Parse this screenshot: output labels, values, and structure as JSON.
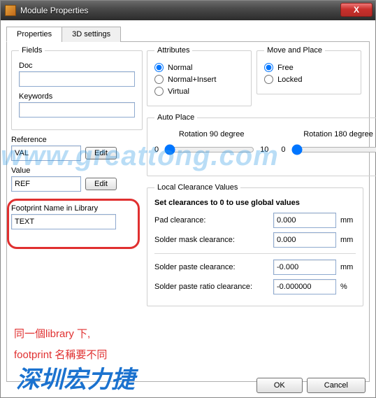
{
  "window": {
    "title": "Module Properties",
    "close": "X"
  },
  "tabs": {
    "properties": "Properties",
    "threeD": "3D settings"
  },
  "fields": {
    "legend": "Fields",
    "doc_label": "Doc",
    "doc_value": "",
    "keywords_label": "Keywords",
    "keywords_value": ""
  },
  "reference": {
    "label": "Reference",
    "value": "VAL",
    "edit": "Edit"
  },
  "value": {
    "label": "Value",
    "value": "REF",
    "edit": "Edit"
  },
  "footprint": {
    "label": "Footprint Name in Library",
    "value": "TEXT"
  },
  "attributes": {
    "legend": "Attributes",
    "normal": "Normal",
    "normal_insert": "Normal+Insert",
    "virtual": "Virtual",
    "selected": "normal"
  },
  "move": {
    "legend": "Move and Place",
    "free": "Free",
    "locked": "Locked",
    "selected": "free"
  },
  "autoplace": {
    "legend": "Auto Place",
    "rot90": "Rotation 90 degree",
    "rot180": "Rotation 180 degree",
    "min": "0",
    "max": "10",
    "val90": 0,
    "val180": 0
  },
  "clearance": {
    "legend": "Local Clearance Values",
    "header": "Set clearances to 0 to use global values",
    "pad_label": "Pad clearance:",
    "pad_value": "0.000",
    "pad_unit": "mm",
    "mask_label": "Solder mask clearance:",
    "mask_value": "0.000",
    "mask_unit": "mm",
    "paste_label": "Solder paste clearance:",
    "paste_value": "-0.000",
    "paste_unit": "mm",
    "ratio_label": "Solder paste ratio clearance:",
    "ratio_value": "-0.000000",
    "ratio_unit": "%"
  },
  "buttons": {
    "ok": "OK",
    "cancel": "Cancel"
  },
  "annotations": {
    "line1": "同一個library 下,",
    "line2": "footprint 名稱要不同"
  },
  "watermark": {
    "url": "www.greattong.com",
    "brand": "深圳宏力捷"
  }
}
